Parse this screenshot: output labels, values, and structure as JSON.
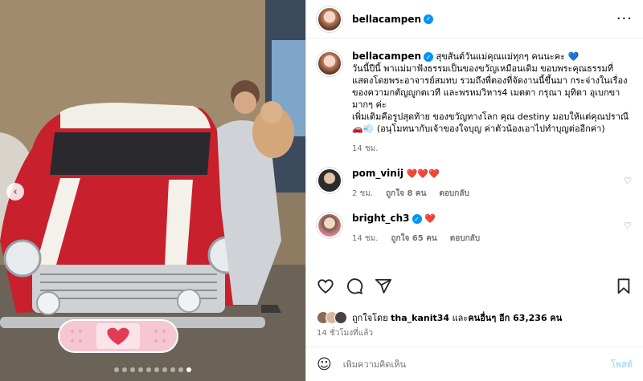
{
  "photo": {
    "nav_prev_icon": "chevron-left-icon",
    "dots_count": 10,
    "active_dot": 9
  },
  "header": {
    "username": "bellacampen",
    "verified_icon": "verified-badge-icon",
    "more_icon": "more-horizontal-icon"
  },
  "caption": {
    "username": "bellacampen",
    "lines": [
      "สุขสันต์วันแม่คุณแม่ทุกๆ คนนะคะ 💙",
      "วันนี้ปีนี้ พาแม่มาฟังธรรมเป็นของขวัญเหมือนเดิม ขอบพระคุณธรรมที่แสดงโดยพระอาจารย์สมทบ รวมถึงพี่ตองที่จัดงานนี้ขึ้นมา กระจ่างในเรื่องของความกตัญญูกตเวที และพรหมวิหาร4 เมตตา กรุณา มุทิตา อุเบกขามากๆ ค่ะ",
      "เพิ่มเติมคือรูปสุดท้าย ของขวัญทางโลก คุณ destiny มอบให้แต่คุณปราณี 🚗💨 (อนุโมทนากับเจ้าของใจบุญ ค่าตัวน้องเอาไปทำบุญต่ออีกค่า)"
    ],
    "time": "14 ชม."
  },
  "comments": [
    {
      "username": "pom_vinij",
      "verified": false,
      "text": "❤️❤️❤️",
      "time": "2 ชม.",
      "likes": "ถูกใจ 8 คน",
      "reply": "ตอบกลับ"
    },
    {
      "username": "bright_ch3",
      "verified": true,
      "text": "❤️",
      "time": "14 ชม.",
      "likes": "ถูกใจ 65 คน",
      "reply": "ตอบกลับ"
    }
  ],
  "actions": {
    "like_icon": "heart-icon",
    "comment_icon": "comment-icon",
    "share_icon": "share-icon",
    "save_icon": "bookmark-icon"
  },
  "likes": {
    "prefix": "ถูกใจโดย",
    "user": "tha_kanit34",
    "middle": "และ",
    "others": "คนอื่นๆ อีก 63,236 คน"
  },
  "time_ago": "14 ชั่วโมงที่แล้ว",
  "composer": {
    "emoji_icon": "smiley-icon",
    "placeholder": "เพิ่มความคิดเห็น",
    "post_label": "โพสต์"
  },
  "colors": {
    "verified": "#0095f6",
    "heart": "#ed4956",
    "car_red": "#c8202d",
    "muted": "#737373"
  }
}
